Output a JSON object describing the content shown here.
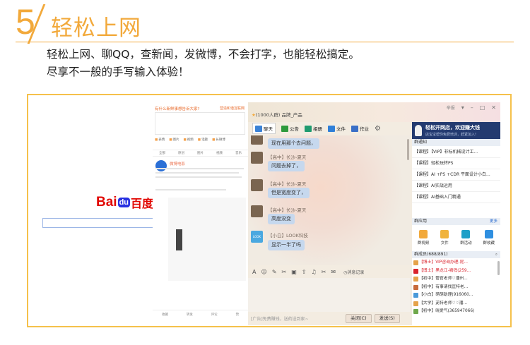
{
  "header": {
    "number": "5",
    "title": "轻松上网",
    "desc_line1": "轻松上网、聊QQ，查新闻，发微博，不会打字，也能轻松搞定。",
    "desc_line2": "尽享不一般的手写输入体验！"
  },
  "colors": {
    "accent": "#f2a93b",
    "frame": "#f5c14b",
    "bubble": "#c6d8ee",
    "promo": "#233a70"
  },
  "baidu": {
    "logo_bai": "Bai",
    "logo_du": "du",
    "logo_cn": "百度"
  },
  "weibo": {
    "top_text": "有什么新鲜事想告诉大家?",
    "top_link": "营造和谐互联网",
    "tools": [
      "表情",
      "图片",
      "视频",
      "话题",
      "长微博"
    ],
    "tabs": [
      "全部",
      "原创",
      "图片",
      "视频",
      "音乐"
    ],
    "poster": "微博电影",
    "footer": [
      "收藏",
      "转发",
      "评论",
      "赞"
    ]
  },
  "qq": {
    "title": "(1000人群) 品牌_产品",
    "window_controls": [
      "举报",
      "▾",
      "–",
      "□",
      "✕"
    ],
    "tabs": [
      "聊天",
      "公告",
      "相册",
      "文件",
      "作业"
    ],
    "messages": [
      {
        "text": "现在用那个去问题，"
      },
      {
        "meta": "【高中】长沙-夏天",
        "text": "问题去掉了，"
      },
      {
        "meta": "【高中】长沙-夏天",
        "text": "但是宽度变了，"
      },
      {
        "meta": "【高中】长沙-夏天",
        "text": "高度没变"
      },
      {
        "meta": "【小白】LOOK科技",
        "text": "显示一半了吗",
        "avatar": "LOOK"
      }
    ],
    "toolbar_icons": [
      "A",
      "☺",
      "✎",
      "✂",
      "▣",
      "⇪",
      "♫",
      "✂",
      "✉"
    ],
    "record_label": "消息记录",
    "ad_text": "[广告]免费赚钱，送药送到家~",
    "close_button": "关闭(C)",
    "send_button": "发送(S)",
    "promo": {
      "title": "轻松开网店，欢迎赚大钱",
      "sub": "店宝宝帮你免费培训，赶紧加入!"
    },
    "notice_header": "群通知",
    "notices": [
      "【课程】【VIP】非标机械设计工...",
      "【课程】轻松玩转PS",
      "【课程】AI +PS +CDR 平面设计小白...",
      "【课程】AI实战运用",
      "【课程】AI基础入门精通"
    ],
    "apps_header": "群应用",
    "apps_more": "更多",
    "apps": [
      "群视频",
      "文件",
      "群活动",
      "群收藏"
    ],
    "members_header": "群成员(688/891)",
    "members": [
      "【博士】VIP咨询办理-昆...",
      "【博士】黑龙江-啸铧(259...",
      "【初中】管官老师♡潘州...",
      "【初中】有事请找匡特老...",
      "【小白】萌萌助理(916060...",
      "【大学】茈特老师♡♡潘...",
      "【初中】晓爱气(365947066)"
    ]
  }
}
